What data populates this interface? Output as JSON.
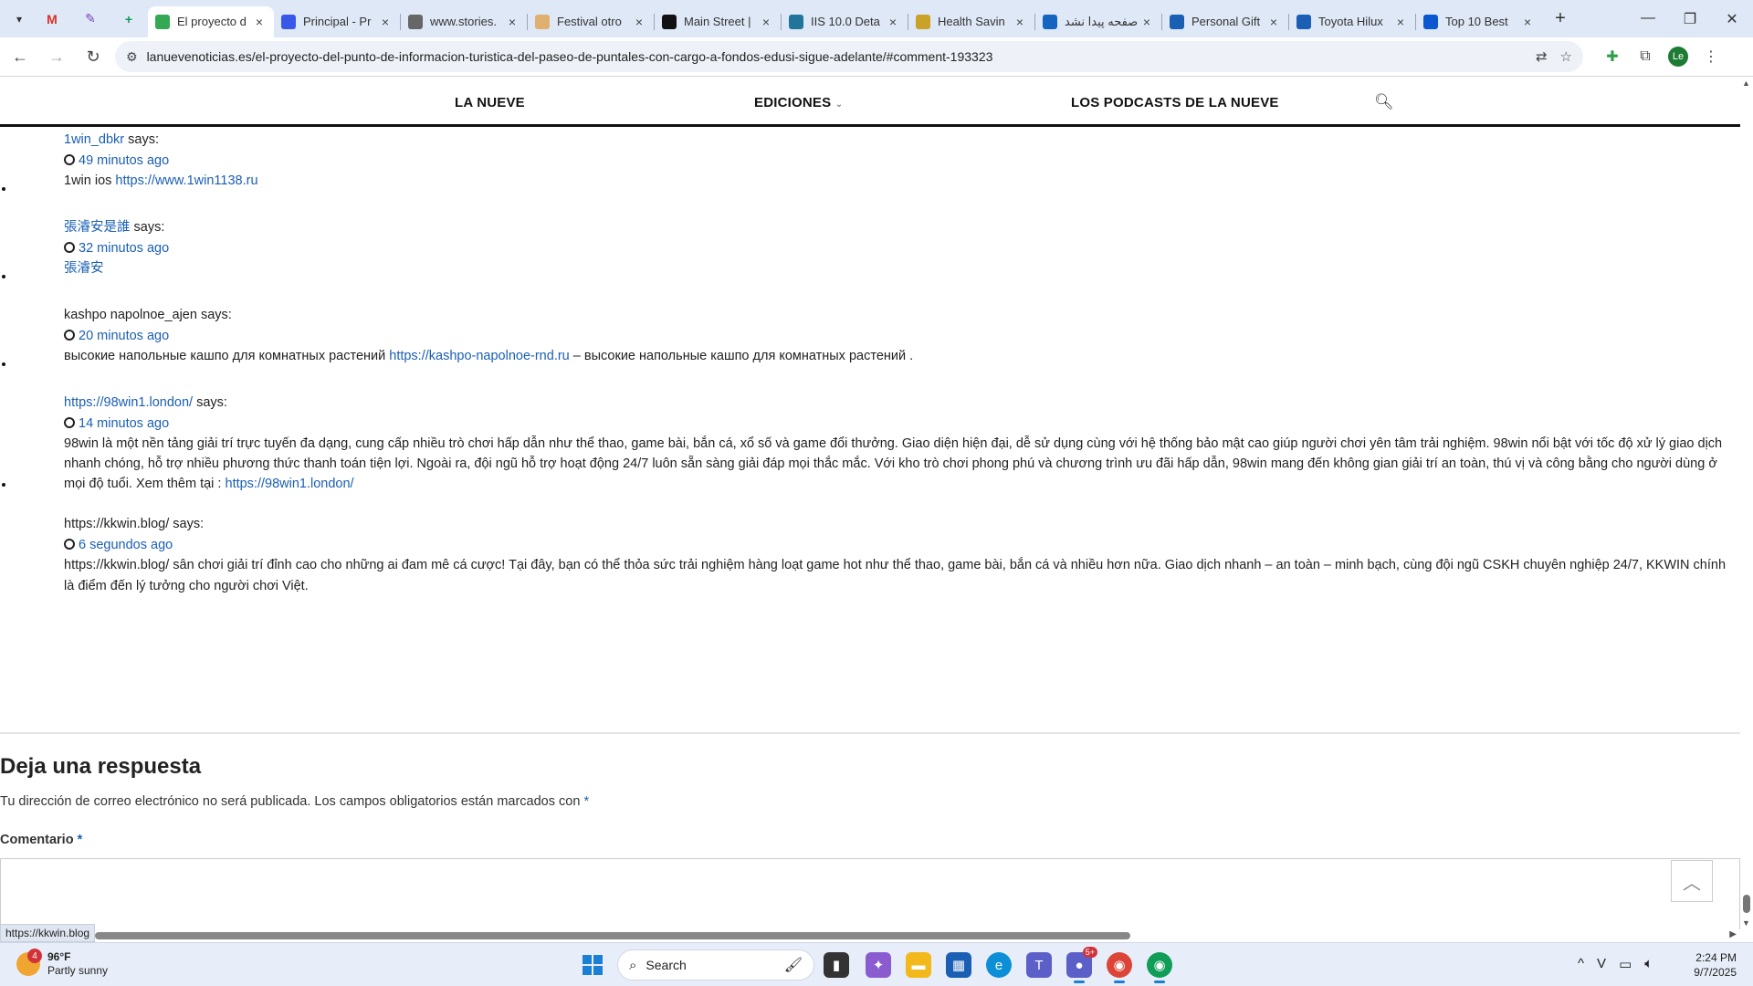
{
  "browser": {
    "pinned": [
      {
        "name": "gmail-icon",
        "glyph": "M",
        "color": "#d93025"
      },
      {
        "name": "pen-icon",
        "glyph": "✎",
        "color": "#7b3fbf"
      },
      {
        "name": "sheets-icon",
        "glyph": "+",
        "color": "#0f9d58"
      }
    ],
    "tabs": [
      {
        "title": "El proyecto d",
        "active": true,
        "fav": "maps-pin-icon",
        "favColor": "#34a853"
      },
      {
        "title": "Principal - Pr",
        "fav": "wordpress-icon",
        "favColor": "#3858e9"
      },
      {
        "title": "www.stories.",
        "fav": "globe-icon",
        "favColor": "#666"
      },
      {
        "title": "Festival otro",
        "fav": "image-icon",
        "favColor": "#e0b070"
      },
      {
        "title": "Main Street |",
        "fav": "shield-icon",
        "favColor": "#111"
      },
      {
        "title": "IIS 10.0 Deta",
        "fav": "wordpress-icon",
        "favColor": "#21759b"
      },
      {
        "title": "Health Savin",
        "fav": "card-icon",
        "favColor": "#c9a227"
      },
      {
        "title": "صفحه پیدا نشد",
        "fav": "feather-icon",
        "favColor": "#1565c0"
      },
      {
        "title": "Personal Gift",
        "fav": "c-icon",
        "favColor": "#1a5fb4"
      },
      {
        "title": "Toyota Hilux",
        "fav": "c-icon",
        "favColor": "#1a5fb4"
      },
      {
        "title": "Top 10 Best",
        "fav": "book-icon",
        "favColor": "#0b57d0"
      }
    ],
    "url": "lanuevenoticias.es/el-proyecto-del-punto-de-informacion-turistica-del-paseo-de-puntales-con-cargo-a-fondos-edusi-sigue-adelante/#comment-193323",
    "profile_initials": "Le",
    "status_url": "https://kkwin.blog"
  },
  "site_nav": {
    "items": [
      "LA NUEVE",
      "EDICIONES",
      "LOS PODCASTS DE LA NUEVE"
    ]
  },
  "comments": [
    {
      "author": "1win_dbkr",
      "author_link": true,
      "says": "says:",
      "time": "49 minutos ago",
      "body_prefix": "1win ios ",
      "body_link": "https://www.1win1138.ru",
      "body_suffix": ""
    },
    {
      "author": "張濬安是誰",
      "author_link": true,
      "says": "says:",
      "time": "32 minutos ago",
      "body_prefix": "",
      "body_link": "張濬安",
      "body_suffix": ""
    },
    {
      "author": "kashpo napolnoe_ajen",
      "author_link": false,
      "says": "says:",
      "time": "20 minutos ago",
      "body_prefix": "высокие напольные кашпо для комнатных растений ",
      "body_link": "https://kashpo-napolnoe-rnd.ru",
      "body_suffix": " – высокие напольные кашпо для комнатных растений ."
    },
    {
      "author": "https://98win1.london/",
      "author_link": true,
      "says": "says:",
      "time": "14 minutos ago",
      "body_prefix": "98win là một nền tảng giải trí trực tuyến đa dạng, cung cấp nhiều trò chơi hấp dẫn như thể thao, game bài, bắn cá, xổ số và game đổi thưởng. Giao diện hiện đại, dễ sử dụng cùng với hệ thống bảo mật cao giúp người chơi yên tâm trải nghiệm. 98win nổi bật với tốc độ xử lý giao dịch nhanh chóng, hỗ trợ nhiều phương thức thanh toán tiện lợi. Ngoài ra, đội ngũ hỗ trợ hoạt động 24/7 luôn sẵn sàng giải đáp mọi thắc mắc. Với kho trò chơi phong phú và chương trình ưu đãi hấp dẫn, 98win mang đến không gian giải trí an toàn, thú vị và công bằng cho người dùng ở mọi độ tuổi. Xem thêm tại : ",
      "body_link": "https://98win1.london/",
      "body_suffix": ""
    },
    {
      "author": "https://kkwin.blog/",
      "author_link": false,
      "says": "says:",
      "time": "6 segundos ago",
      "body_prefix": "https://kkwin.blog/ sân chơi giải trí đỉnh cao cho những ai đam mê cá cược! Tại đây, bạn có thể thỏa sức trải nghiệm hàng loạt game hot như thể thao, game bài, bắn cá và nhiều hơn nữa. Giao dịch nhanh – an toàn – minh bạch, cùng đội ngũ CSKH chuyên nghiệp 24/7, KKWIN chính là điểm đến lý tưởng cho người chơi Việt.",
      "body_link": "",
      "body_suffix": ""
    }
  ],
  "reply": {
    "title": "Deja una respuesta",
    "note": "Tu dirección de correo electrónico no será publicada. Los campos obligatorios están marcados con ",
    "required_mark": "*",
    "comment_label": "Comentario "
  },
  "taskbar": {
    "weather_temp": "96°F",
    "weather_desc": "Partly sunny",
    "weather_badge": "4",
    "search_placeholder": "Search",
    "time": "2:24 PM",
    "date": "9/7/2025",
    "teams_badge": "5+"
  }
}
